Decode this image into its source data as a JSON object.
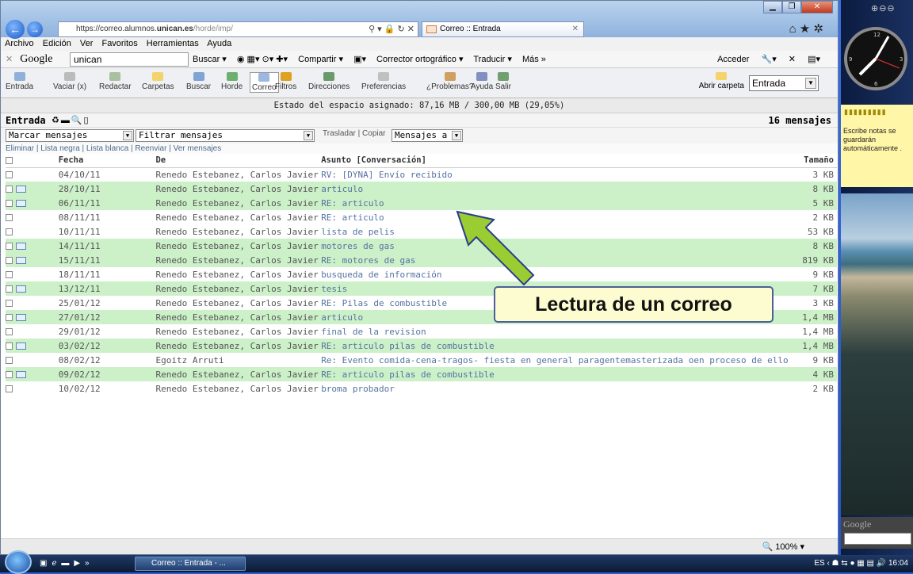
{
  "browser": {
    "url_prefix": "https://correo.alumnos.",
    "url_domain": "unican.es",
    "url_suffix": "/horde/imp/",
    "addr_controls": "⚲ ▾ 🔒 ↻ ✕",
    "tab_title": "Correo :: Entrada",
    "menu": [
      "Archivo",
      "Edición",
      "Ver",
      "Favoritos",
      "Herramientas",
      "Ayuda"
    ]
  },
  "googlebar": {
    "logo": "Google",
    "query": "unican",
    "buscar": "Buscar ▾",
    "compartir": "Compartir ▾",
    "corrector": "Corrector ortográfico ▾",
    "traducir": "Traducir ▾",
    "mas": "Más »",
    "acceder": "Acceder"
  },
  "horde": {
    "buttons": [
      "Entrada",
      "Vaciar (x)",
      "Redactar",
      "Carpetas",
      "Buscar",
      "Horde",
      "Correo",
      "Filtros",
      "Direcciones",
      "Preferencias",
      "¿Problemas?",
      "Ayuda",
      "Salir"
    ],
    "abrir_carpeta": "Abrir carpeta",
    "folder_select": "Entrada"
  },
  "quota": "Estado del espacio asignado: 87,16 MB / 300,00 MB (29,05%)",
  "folder": {
    "name": "Entrada",
    "count": "16 mensajes"
  },
  "actions": {
    "marcar": "Marcar mensajes",
    "filtrar": "Filtrar mensajes",
    "trasladar": "Trasladar",
    "copiar": "Copiar",
    "mensajes_a": "Mensajes a",
    "links": "Eliminar | Lista negra | Lista blanca | Reenviar | Ver mensajes"
  },
  "columns": {
    "fecha": "Fecha",
    "de": "De",
    "asunto": "Asunto [Conversación]",
    "tamano": "Tamaño"
  },
  "messages": [
    {
      "date": "04/10/11",
      "from": "Renedo Estebanez, Carlos Javier",
      "subject": "RV: [DYNA] Envío recibido",
      "size": "3 KB",
      "replied": false
    },
    {
      "date": "28/10/11",
      "from": "Renedo Estebanez, Carlos Javier",
      "subject": "articulo",
      "size": "8 KB",
      "replied": true
    },
    {
      "date": "06/11/11",
      "from": "Renedo Estebanez, Carlos Javier",
      "subject": "RE: articulo",
      "size": "5 KB",
      "replied": true
    },
    {
      "date": "08/11/11",
      "from": "Renedo Estebanez, Carlos Javier",
      "subject": "RE: articulo",
      "size": "2 KB",
      "replied": false
    },
    {
      "date": "10/11/11",
      "from": "Renedo Estebanez, Carlos Javier",
      "subject": "lista de pelis",
      "size": "53 KB",
      "replied": false
    },
    {
      "date": "14/11/11",
      "from": "Renedo Estebanez, Carlos Javier",
      "subject": "motores de gas",
      "size": "8 KB",
      "replied": true
    },
    {
      "date": "15/11/11",
      "from": "Renedo Estebanez, Carlos Javier",
      "subject": "RE: motores de gas",
      "size": "819 KB",
      "replied": true
    },
    {
      "date": "18/11/11",
      "from": "Renedo Estebanez, Carlos Javier",
      "subject": "busqueda de información",
      "size": "9 KB",
      "replied": false
    },
    {
      "date": "13/12/11",
      "from": "Renedo Estebanez, Carlos Javier",
      "subject": "tesis",
      "size": "7 KB",
      "replied": true
    },
    {
      "date": "25/01/12",
      "from": "Renedo Estebanez, Carlos Javier",
      "subject": "RE: Pilas de combustible",
      "size": "3 KB",
      "replied": false
    },
    {
      "date": "27/01/12",
      "from": "Renedo Estebanez, Carlos Javier",
      "subject": "articulo",
      "size": "1,4 MB",
      "replied": true
    },
    {
      "date": "29/01/12",
      "from": "Renedo Estebanez, Carlos Javier",
      "subject": "final de la revision",
      "size": "1,4 MB",
      "replied": false
    },
    {
      "date": "03/02/12",
      "from": "Renedo Estebanez, Carlos Javier",
      "subject": "RE: articulo pilas de combustible",
      "size": "1,4 MB",
      "replied": true
    },
    {
      "date": "08/02/12",
      "from": "Egoitz Arruti",
      "subject": "Re: Evento comida-cena-tragos- fiesta en general paragentemasterizada oen proceso de ello",
      "size": "9 KB",
      "replied": false
    },
    {
      "date": "09/02/12",
      "from": "Renedo Estebanez, Carlos Javier",
      "subject": "RE: articulo pilas de combustible",
      "size": "4 KB",
      "replied": true
    },
    {
      "date": "10/02/12",
      "from": "Renedo Estebanez, Carlos Javier",
      "subject": "broma probador",
      "size": "2 KB",
      "replied": false
    }
  ],
  "callout": "Lectura de un correo",
  "statusbar": {
    "zoom": "100%"
  },
  "sidebar": {
    "note": "Escribe notas se guardarán automáticamente .",
    "google": "Google"
  },
  "taskbar": {
    "task": "Correo :: Entrada - ...",
    "lang": "ES",
    "time": "16:04"
  },
  "colors": {
    "accent": "#2350c8",
    "row_highlight": "#ccf0c8",
    "arrow": "#9acd32",
    "callout_bg": "#fdfcd0"
  }
}
